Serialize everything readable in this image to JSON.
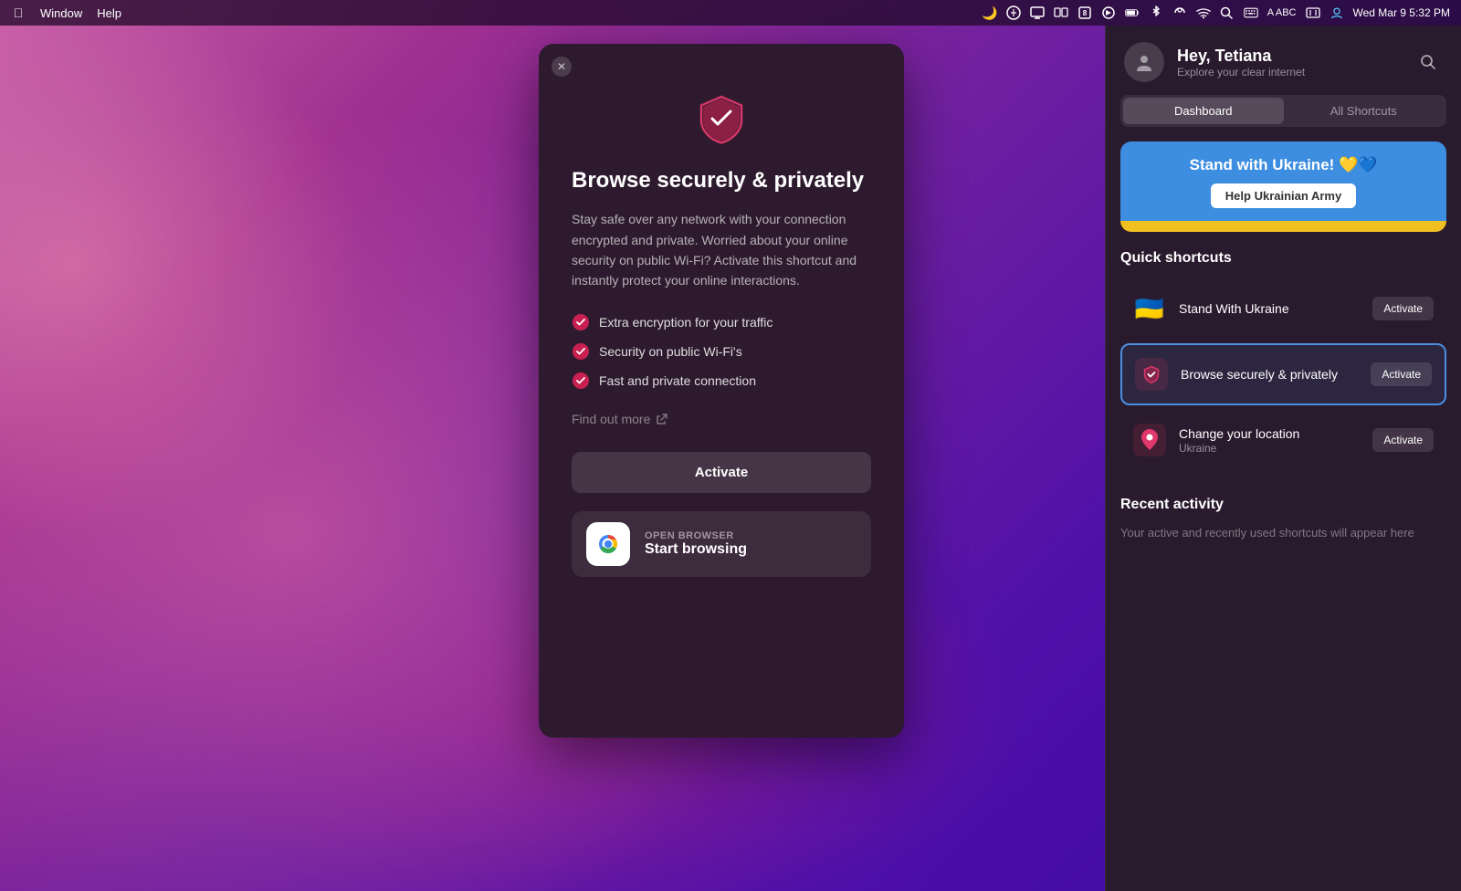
{
  "menubar": {
    "left": [
      "Window",
      "Help"
    ],
    "right_time": "Wed Mar 9  5:32 PM"
  },
  "panel": {
    "title": "Browse securely & privately",
    "description": "Stay safe over any network with your connection encrypted and private. Worried about your online security on public Wi-Fi? Activate this shortcut and instantly protect your online interactions.",
    "features": [
      "Extra encryption for your traffic",
      "Security on public Wi-Fi's",
      "Fast and private connection"
    ],
    "find_out_more": "Find out more",
    "activate_label": "Activate",
    "open_browser_label": "OPEN BROWSER",
    "start_browsing_label": "Start browsing"
  },
  "sidebar": {
    "greeting": "Hey, Tetiana",
    "subtitle": "Explore your clear internet",
    "tabs": [
      "Dashboard",
      "All Shortcuts"
    ],
    "ukraine_banner": {
      "title": "Stand with Ukraine! 💛💙",
      "button": "Help Ukrainian Army"
    },
    "quick_shortcuts_title": "Quick shortcuts",
    "shortcuts": [
      {
        "name": "Stand With Ukraine",
        "sub": "",
        "icon_type": "ukraine-flag",
        "activate": "Activate"
      },
      {
        "name": "Browse securely & privately",
        "sub": "",
        "icon_type": "pink-shield",
        "activate": "Activate",
        "highlighted": true
      },
      {
        "name": "Change your location",
        "sub": "Ukraine",
        "icon_type": "location",
        "activate": "Activate"
      }
    ],
    "recent_activity_title": "Recent activity",
    "recent_empty": "Your active and recently used shortcuts will appear here"
  }
}
